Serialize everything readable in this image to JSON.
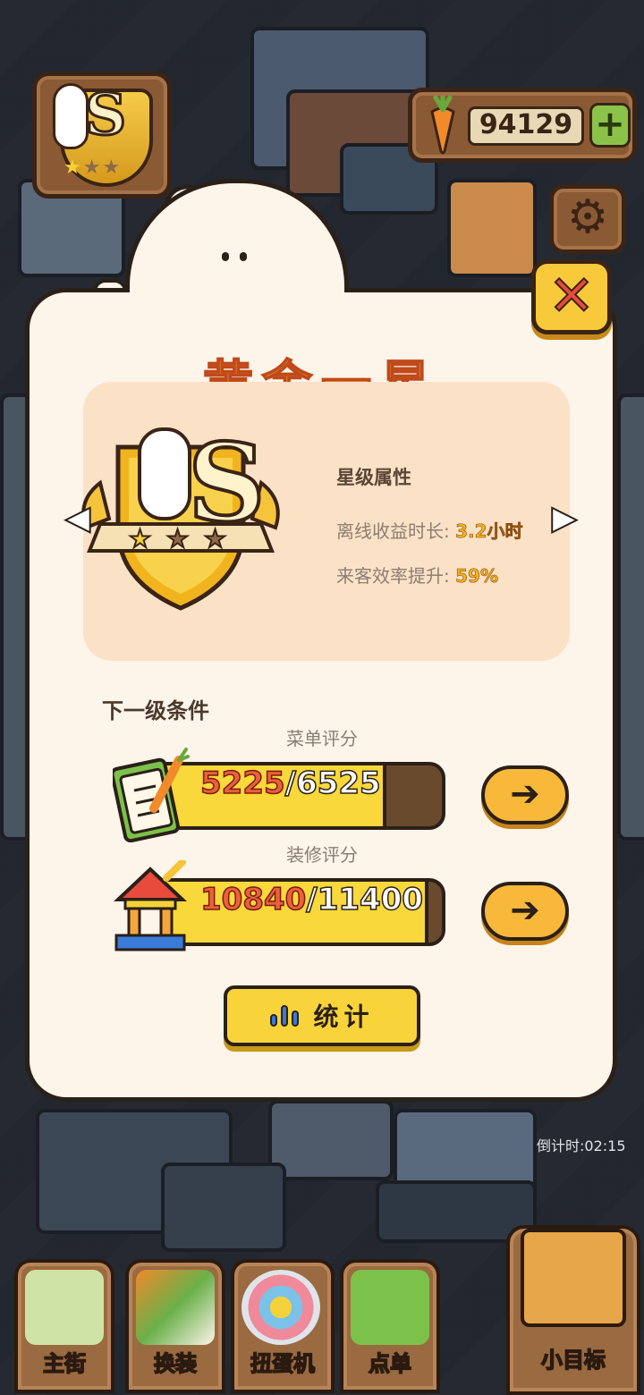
{
  "hud": {
    "carrots": "94129",
    "plus_icon": "plus-icon",
    "settings_icon": "gear-icon",
    "close_icon": "close-icon"
  },
  "modal": {
    "title": "黄金一星",
    "stats": {
      "heading": "星级属性",
      "offline_label": "离线收益时长:",
      "offline_value": "3.2小时",
      "efficiency_label": "来客效率提升:",
      "efficiency_value": "59%"
    },
    "next_level": {
      "heading": "下一级条件",
      "menu_score": {
        "label": "菜单评分",
        "current": "5225",
        "separator": "/",
        "max": "6525",
        "progress": 0.8
      },
      "decor_score": {
        "label": "装修评分",
        "current": "10840",
        "separator": "/",
        "max": "11400",
        "progress": 0.95
      }
    },
    "stats_button": "统计"
  },
  "countdown": "倒计时:02:15",
  "bottom_nav": [
    {
      "label": "主街",
      "icon": "map-icon"
    },
    {
      "label": "换装",
      "icon": "paint-roller-icon"
    },
    {
      "label": "扭蛋机",
      "icon": "gacha-icon"
    },
    {
      "label": "点单",
      "icon": "order-icon"
    }
  ],
  "goal": {
    "label": "小目标",
    "icon": "flag-icon"
  },
  "colors": {
    "accent_yellow": "#f8d43a",
    "title_orange": "#f0a43a",
    "value_gold": "#f2b21c",
    "panel_cream": "#fdf4ea",
    "card_peach": "#fbe1c6"
  }
}
